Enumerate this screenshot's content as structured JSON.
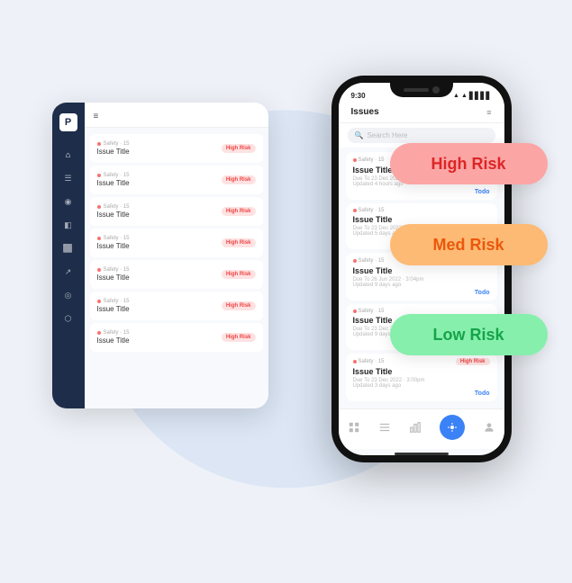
{
  "scene": {
    "statusBar": {
      "time": "9:30",
      "icons": "▲▲▲"
    },
    "phone": {
      "appTitle": "Issues",
      "searchPlaceholder": "Search Here",
      "rows": [
        {
          "meta": "Safety · 15",
          "title": "Issue Title",
          "date": "Due To 23 Dec 2022 · 3:00pm",
          "updated": "Updated 4 hours ago",
          "badge": "High Risk",
          "badgeClass": "high",
          "todo": "Todo"
        },
        {
          "meta": "Safety · 15",
          "title": "Issue Title",
          "date": "Due To 23 Dec 2022 · 3:00pm",
          "updated": "Updated 5 days ago",
          "badge": "",
          "badgeClass": "",
          "todo": "Todo"
        },
        {
          "meta": "Safety · 15",
          "title": "Issue Title",
          "date": "Due To 26 Jun 2022 · 3:04pm",
          "updated": "Updated 9 days ago",
          "badge": "Med Risk",
          "badgeClass": "med",
          "todo": "Todo"
        },
        {
          "meta": "Safety · 15",
          "title": "Issue Title",
          "date": "Due To 23 Dec 2022 · 3:00pm",
          "updated": "Updated 9 days ago",
          "badge": "",
          "badgeClass": "",
          "todo": "Todo"
        },
        {
          "meta": "Safety · 15",
          "title": "Issue Title",
          "date": "Due To 23 Dec 2022 · 3:00pm",
          "updated": "Updated 3 days ago",
          "badge": "High Risk",
          "badgeClass": "high",
          "todo": "Todo"
        }
      ],
      "nav": [
        "🏠",
        "📋",
        "📊",
        "🔵",
        "👤"
      ]
    },
    "tablet": {
      "rows": [
        {
          "meta": "Safety · 15",
          "title": "Issue Title",
          "badge": "High Risk"
        },
        {
          "meta": "Safety · 15",
          "title": "Issue Title",
          "badge": "High Risk"
        },
        {
          "meta": "Safety · 15",
          "title": "Issue Title",
          "badge": "High Risk"
        },
        {
          "meta": "Safety · 15",
          "title": "Issue Title",
          "badge": "High Risk"
        },
        {
          "meta": "Safety · 15",
          "title": "Issue Title",
          "badge": "High Risk"
        },
        {
          "meta": "Safety · 15",
          "title": "Issue Title",
          "badge": "High Risk"
        },
        {
          "meta": "Safety · 15",
          "title": "Issue Title",
          "badge": "High Risk"
        }
      ]
    },
    "riskBadges": {
      "high": "High Risk",
      "med": "Med Risk",
      "low": "Low Risk"
    }
  }
}
